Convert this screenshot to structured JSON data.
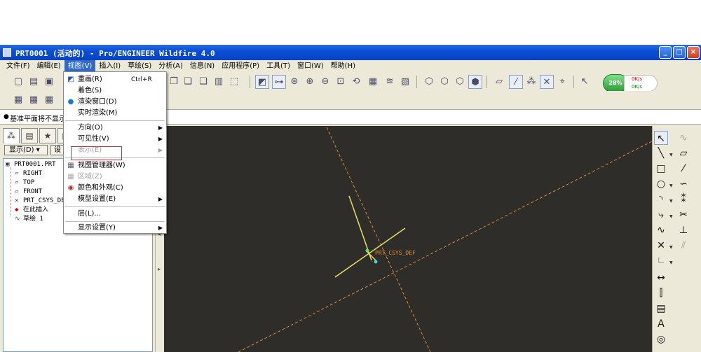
{
  "window": {
    "title": "PRT0001 (活动的) - Pro/ENGINEER Wildfire 4.0",
    "minimize": "_",
    "maximize": "□",
    "close": "×"
  },
  "menubar": [
    {
      "label": "文件(F)"
    },
    {
      "label": "编辑(E)"
    },
    {
      "label": "视图(V)"
    },
    {
      "label": "插入(I)"
    },
    {
      "label": "草绘(S)"
    },
    {
      "label": "分析(A)"
    },
    {
      "label": "信息(N)"
    },
    {
      "label": "应用程序(P)"
    },
    {
      "label": "工具(T)"
    },
    {
      "label": "窗口(W)"
    },
    {
      "label": "帮助(H)"
    }
  ],
  "view_menu": {
    "items": [
      {
        "label": "重画(R)",
        "shortcut": "Ctrl+R",
        "icon": "repaint-icon"
      },
      {
        "label": "着色(S)",
        "icon": ""
      },
      {
        "label": "渲染窗口(D)",
        "icon": "render-icon"
      },
      {
        "label": "实时渲染(M)",
        "icon": ""
      },
      {
        "label": "方向(O)",
        "submenu": "▶"
      },
      {
        "label": "可见性(V)",
        "submenu": "▶"
      },
      {
        "label": "表示(E)",
        "submenu": "▶",
        "disabled": true
      },
      {
        "label": "视图管理器(W)",
        "icon": "view-manager-icon"
      },
      {
        "label": "区域(Z)",
        "icon": "region-icon",
        "disabled": true
      },
      {
        "label": "颜色和外观(C)",
        "icon": "appearance-icon"
      },
      {
        "label": "模型设置(E)",
        "submenu": "▶"
      },
      {
        "label": "层(L)...",
        "icon": ""
      },
      {
        "label": "显示设置(Y)",
        "submenu": "▶"
      }
    ]
  },
  "message": {
    "text": "基准平面将不显示"
  },
  "left_panel": {
    "show_label": "显示(D) ▾",
    "settings_label": "设",
    "tree": [
      {
        "label": "PRT0001.PRT",
        "icon": "part-icon"
      },
      {
        "label": "RIGHT",
        "icon": "datum-plane-icon"
      },
      {
        "label": "TOP",
        "icon": "datum-plane-icon"
      },
      {
        "label": "FRONT",
        "icon": "datum-plane-icon"
      },
      {
        "label": "PRT_CSYS_DEF",
        "icon": "csys-icon"
      },
      {
        "label": "在此插入",
        "icon": "insert-here-icon"
      },
      {
        "label": "草绘 1",
        "icon": "sketch-icon"
      }
    ]
  },
  "status_meter": {
    "percent": "28%",
    "up_rate": "0K/s",
    "down_rate": "0K/s"
  },
  "viewport": {
    "csys_label": "PRT_CSYS_DEF",
    "colors": {
      "background": "#2f2d2a",
      "datum": "#d8893a",
      "csys_axis": "#e8e060",
      "csys_label": "#d8893a"
    }
  }
}
